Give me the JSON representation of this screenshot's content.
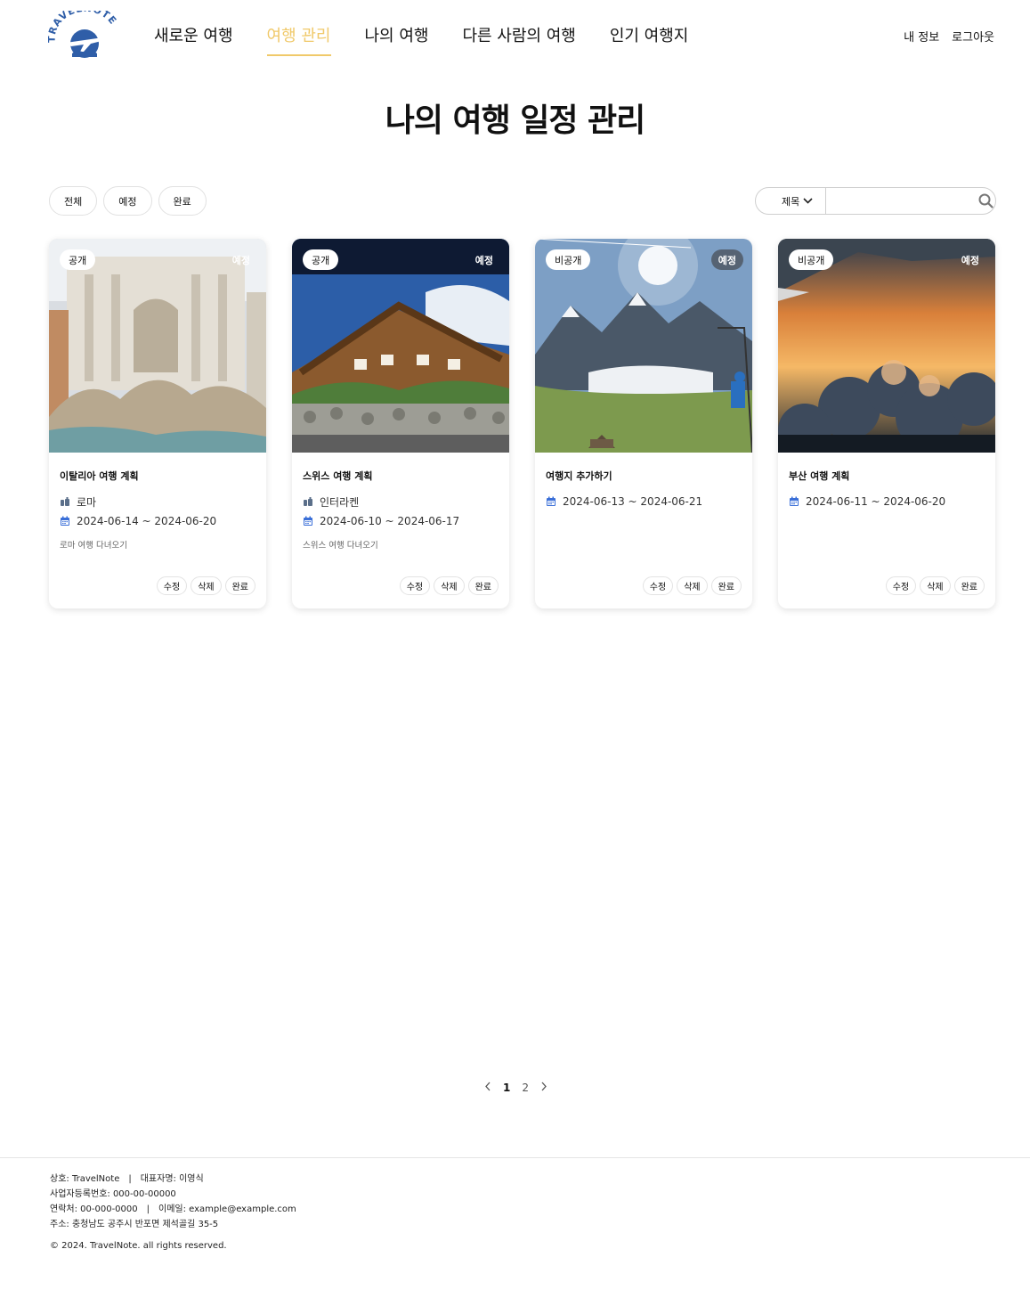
{
  "header": {
    "logo_text": "TRAVELNOTE",
    "nav": [
      {
        "label": "새로운 여행"
      },
      {
        "label": "여행 관리"
      },
      {
        "label": "나의 여행"
      },
      {
        "label": "다른 사람의 여행"
      },
      {
        "label": "인기 여행지"
      }
    ],
    "user_menu": {
      "profile": "내 정보",
      "logout": "로그아웃"
    }
  },
  "page_title": "나의 여행 일정 관리",
  "filters": [
    "전체",
    "예정",
    "완료"
  ],
  "search": {
    "select_value": "제목",
    "input_value": "",
    "placeholder": ""
  },
  "cards": [
    {
      "visibility": "공개",
      "status": "예정",
      "title": "이탈리아 여행 계획",
      "location": "로마",
      "dates": "2024-06-14 ~ 2024-06-20",
      "desc": "로마 여행 다녀오기",
      "actions": [
        "수정",
        "삭제",
        "완료"
      ]
    },
    {
      "visibility": "공개",
      "status": "예정",
      "title": "스위스 여행 계획",
      "location": "인터라켄",
      "dates": "2024-06-10 ~ 2024-06-17",
      "desc": "스위스 여행 다녀오기",
      "actions": [
        "수정",
        "삭제",
        "완료"
      ]
    },
    {
      "visibility": "비공개",
      "status": "예정",
      "title": "여행지 추가하기",
      "location": "",
      "dates": "2024-06-13 ~ 2024-06-21",
      "desc": "",
      "actions": [
        "수정",
        "삭제",
        "완료"
      ]
    },
    {
      "visibility": "비공개",
      "status": "예정",
      "title": "부산 여행 계획",
      "location": "",
      "dates": "2024-06-11 ~ 2024-06-20",
      "desc": "",
      "actions": [
        "수정",
        "삭제",
        "완료"
      ]
    }
  ],
  "pagination": {
    "pages": [
      "1",
      "2"
    ],
    "current": "1"
  },
  "footer": {
    "company": "상호: TravelNote",
    "ceo": "대표자명: 이영식",
    "biz_no": "사업자등록번호: 000-00-00000",
    "phone": "연락처: 00-000-0000",
    "email": "이메일: example@example.com",
    "address": "주소: 충청남도 공주시 반포면 제석골길 35-5",
    "copyright": "© 2024. TravelNote. all rights reserved.",
    "divider": "|"
  },
  "colors": {
    "accent": "#f0c96a",
    "icon_blue": "#3a6fd8"
  }
}
